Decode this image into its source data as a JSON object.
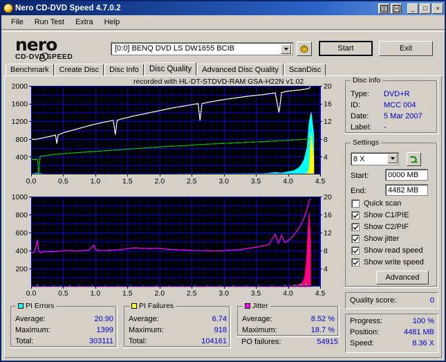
{
  "window": {
    "title": "Nero CD-DVD Speed 4.7.0.2",
    "icon": "nero-disc-icon",
    "buttons": {
      "copy": "copy-icon",
      "save": "save-icon",
      "minimize": "_",
      "maximize": "□",
      "close": "×"
    }
  },
  "menu": {
    "items": [
      "File",
      "Run Test",
      "Extra",
      "Help"
    ]
  },
  "logo": {
    "name": "nero",
    "subtitle_left": "CD·DVD",
    "subtitle_right": "SPEED"
  },
  "toolbar": {
    "drive": "[0:0]   BENQ DVD LS DW1655 BCIB",
    "eject_icon": "eject-disc-icon",
    "start_label": "Start",
    "exit_label": "Exit"
  },
  "tabs": {
    "items": [
      "Benchmark",
      "Create Disc",
      "Disc Info",
      "Disc Quality",
      "Advanced Disc Quality",
      "ScanDisc"
    ],
    "active": "Disc Quality"
  },
  "disc_info": {
    "title": "Disc info",
    "rows": [
      {
        "label": "Type:",
        "value": "DVD+R"
      },
      {
        "label": "ID:",
        "value": "MCC 004"
      },
      {
        "label": "Date:",
        "value": "5 Mar 2007"
      },
      {
        "label": "Label:",
        "value": "-"
      }
    ]
  },
  "settings": {
    "title": "Settings",
    "speed": "8 X",
    "refresh_icon": "refresh-icon",
    "start_label": "Start:",
    "start_value": "0000 MB",
    "end_label": "End:",
    "end_value": "4482 MB",
    "checkboxes": [
      {
        "label": "Quick scan",
        "checked": false
      },
      {
        "label": "Show C1/PIE",
        "checked": true
      },
      {
        "label": "Show C2/PIF",
        "checked": true
      },
      {
        "label": "Show jitter",
        "checked": true
      },
      {
        "label": "Show read speed",
        "checked": true
      },
      {
        "label": "Show write speed",
        "checked": true
      }
    ],
    "advanced_label": "Advanced"
  },
  "quality": {
    "label": "Quality score:",
    "value": "0"
  },
  "status": {
    "rows": [
      {
        "label": "Progress:",
        "value": "100 %"
      },
      {
        "label": "Position:",
        "value": "4481 MB"
      },
      {
        "label": "Speed:",
        "value": "8.36 X"
      }
    ]
  },
  "stats": {
    "pi_errors": {
      "title": "PI Errors",
      "color": "#00ffff",
      "rows": [
        {
          "label": "Average:",
          "value": "20.90"
        },
        {
          "label": "Maximum:",
          "value": "1399"
        },
        {
          "label": "Total:",
          "value": "303111"
        }
      ]
    },
    "pi_failures": {
      "title": "PI Failures",
      "color": "#ffff00",
      "rows": [
        {
          "label": "Average:",
          "value": "6.74"
        },
        {
          "label": "Maximum:",
          "value": "918"
        },
        {
          "label": "Total:",
          "value": "104161"
        }
      ]
    },
    "jitter": {
      "title": "Jitter",
      "color": "#ff00ff",
      "rows": [
        {
          "label": "Average:",
          "value": "8.52 %"
        },
        {
          "label": "Maximum:",
          "value": "18.7 %"
        }
      ]
    },
    "po_failures": {
      "label": "PO failures:",
      "value": "54915"
    }
  },
  "chart_data": [
    {
      "type": "line",
      "id": "pi-chart",
      "title": "recorded with HL-DT-STDVD-RAM GSA-H22N v1.02",
      "xlabel": "",
      "ylabel": "",
      "xlim": [
        0.0,
        4.5
      ],
      "ylim": [
        0,
        2000
      ],
      "y2lim": [
        0,
        20
      ],
      "xticks": [
        0.0,
        0.5,
        1.0,
        1.5,
        2.0,
        2.5,
        3.0,
        3.5,
        4.0,
        4.5
      ],
      "yticks": [
        400,
        800,
        1200,
        1600,
        2000
      ],
      "y2ticks": [
        4,
        8,
        12,
        16,
        20
      ],
      "grid": true,
      "bg": "#000000",
      "gridcolor": "#0000d0",
      "legend": "none",
      "series": [
        {
          "name": "PI Errors",
          "color": "#00ffff",
          "axis": "left",
          "kind": "area",
          "x": [
            0.0,
            0.1,
            0.2,
            0.3,
            0.4,
            0.5,
            0.6,
            0.7,
            0.8,
            0.9,
            1.0,
            1.2,
            1.4,
            1.6,
            1.8,
            2.0,
            2.2,
            2.4,
            2.6,
            2.8,
            3.0,
            3.2,
            3.4,
            3.6,
            3.7,
            3.8,
            3.9,
            4.0,
            4.05,
            4.1,
            4.15,
            4.2,
            4.25,
            4.3,
            4.33,
            4.36,
            4.4
          ],
          "y": [
            5,
            30,
            8,
            6,
            6,
            6,
            6,
            6,
            7,
            7,
            8,
            8,
            8,
            9,
            9,
            10,
            10,
            11,
            12,
            12,
            13,
            14,
            16,
            18,
            26,
            45,
            30,
            60,
            70,
            90,
            130,
            200,
            330,
            620,
            1180,
            1399,
            900
          ]
        },
        {
          "name": "PI Failures",
          "color": "#ffff00",
          "axis": "left",
          "kind": "area",
          "x": [
            0.0,
            0.5,
            1.0,
            1.5,
            2.0,
            2.5,
            3.0,
            3.4,
            3.8,
            4.0,
            4.15,
            4.25,
            4.3,
            4.33,
            4.36,
            4.4
          ],
          "y": [
            1,
            1,
            1,
            1,
            1,
            1,
            2,
            2,
            3,
            4,
            6,
            12,
            30,
            120,
            918,
            400
          ]
        },
        {
          "name": "Read speed",
          "color": "#ffffff",
          "axis": "right",
          "kind": "line",
          "x": [
            0.0,
            0.05,
            0.1,
            0.2,
            0.3,
            0.38,
            0.4,
            0.42,
            0.5,
            0.7,
            0.9,
            1.1,
            1.28,
            1.31,
            1.34,
            1.4,
            1.6,
            1.8,
            2.0,
            2.2,
            2.4,
            2.6,
            2.63,
            2.66,
            2.8,
            3.0,
            3.2,
            3.4,
            3.6,
            3.8,
            3.86,
            3.9,
            4.0,
            4.2,
            4.33,
            4.35,
            4.4
          ],
          "y": [
            8.0,
            7.9,
            8.0,
            8.3,
            8.6,
            8.9,
            7.0,
            8.9,
            9.4,
            10.2,
            11.0,
            11.7,
            12.2,
            9.0,
            12.2,
            12.5,
            13.2,
            13.8,
            14.4,
            15.0,
            15.5,
            16.0,
            12.2,
            16.0,
            16.4,
            16.9,
            17.3,
            17.7,
            18.0,
            18.4,
            14.0,
            18.5,
            18.8,
            19.1,
            19.4,
            20.0,
            20.0
          ]
        },
        {
          "name": "Write speed",
          "color": "#00c000",
          "axis": "right",
          "kind": "line",
          "x": [
            0.0,
            0.05,
            0.1,
            0.12,
            0.14,
            0.3,
            0.6,
            0.9,
            1.2,
            1.5,
            1.8,
            2.1,
            2.4,
            2.7,
            3.0,
            3.3,
            3.6,
            3.9,
            4.1,
            4.25,
            4.33
          ],
          "y": [
            3.4,
            3.4,
            3.4,
            0.0,
            4.1,
            4.4,
            4.8,
            5.1,
            5.4,
            5.7,
            6.0,
            6.3,
            6.5,
            6.8,
            7.0,
            7.2,
            7.4,
            7.6,
            7.8,
            7.9,
            8.0
          ]
        }
      ]
    },
    {
      "type": "line",
      "id": "jitter-chart",
      "title": "",
      "xlabel": "",
      "ylabel": "",
      "xlim": [
        0.0,
        4.5
      ],
      "ylim": [
        0,
        1000
      ],
      "y2lim": [
        0,
        20
      ],
      "xticks": [
        0.0,
        0.5,
        1.0,
        1.5,
        2.0,
        2.5,
        3.0,
        3.5,
        4.0,
        4.5
      ],
      "yticks": [
        200,
        400,
        600,
        800,
        1000
      ],
      "y2ticks": [
        4,
        8,
        12,
        16,
        20
      ],
      "grid": true,
      "bg": "#000000",
      "gridcolor": "#0000d0",
      "legend": "none",
      "series": [
        {
          "name": "Jitter",
          "color": "#ff00ff",
          "axis": "right",
          "kind": "line",
          "x": [
            0.0,
            0.05,
            0.1,
            0.12,
            0.14,
            0.2,
            0.3,
            0.4,
            0.5,
            0.6,
            0.7,
            0.8,
            0.9,
            0.98,
            1.0,
            1.05,
            1.15,
            1.3,
            1.45,
            1.6,
            1.75,
            1.85,
            1.95,
            2.1,
            2.25,
            2.4,
            2.55,
            2.7,
            2.85,
            3.0,
            3.15,
            3.3,
            3.45,
            3.6,
            3.7,
            3.8,
            3.85,
            3.9,
            3.95,
            4.0,
            4.05,
            4.1,
            4.15,
            4.2,
            4.25,
            4.28,
            4.31,
            4.33,
            4.35
          ],
          "y": [
            7.4,
            7.6,
            10.4,
            7.9,
            7.5,
            7.8,
            7.7,
            7.8,
            8.0,
            8.0,
            7.9,
            8.0,
            8.1,
            9.2,
            8.3,
            8.0,
            8.0,
            8.1,
            8.3,
            8.6,
            8.5,
            8.4,
            8.5,
            8.3,
            8.2,
            8.1,
            8.0,
            8.0,
            7.9,
            8.0,
            8.1,
            8.3,
            8.6,
            9.0,
            9.3,
            11.6,
            9.6,
            11.4,
            9.8,
            10.2,
            10.8,
            11.6,
            12.6,
            13.8,
            15.2,
            16.6,
            17.8,
            19.0,
            19.6
          ]
        },
        {
          "name": "PO failures",
          "color": "#ff0080",
          "axis": "right",
          "kind": "area",
          "x": [
            0.0,
            1.0,
            2.0,
            3.0,
            3.6,
            4.0,
            4.15,
            4.22,
            4.26,
            4.29,
            4.31,
            4.33,
            4.35
          ],
          "y": [
            0,
            0,
            0,
            0,
            0,
            0.1,
            0.3,
            0.8,
            2.0,
            6.0,
            12.0,
            16.4,
            10.0
          ]
        },
        {
          "name": "PI Errors baseline",
          "color": "#00ff00",
          "axis": "left",
          "kind": "dots",
          "x": [
            0.1,
            0.2,
            0.35,
            0.45,
            0.6,
            0.75,
            0.95,
            1.15,
            1.35,
            1.55,
            1.75,
            1.95,
            2.15,
            2.35,
            2.55,
            2.75,
            2.95,
            3.15,
            3.35,
            3.55,
            3.75,
            3.95,
            4.1,
            4.2,
            4.28
          ],
          "y": [
            12,
            6,
            6,
            6,
            6,
            6,
            6,
            6,
            6,
            6,
            6,
            6,
            6,
            6,
            6,
            6,
            6,
            6,
            6,
            6,
            8,
            10,
            14,
            20,
            30
          ]
        }
      ]
    }
  ]
}
